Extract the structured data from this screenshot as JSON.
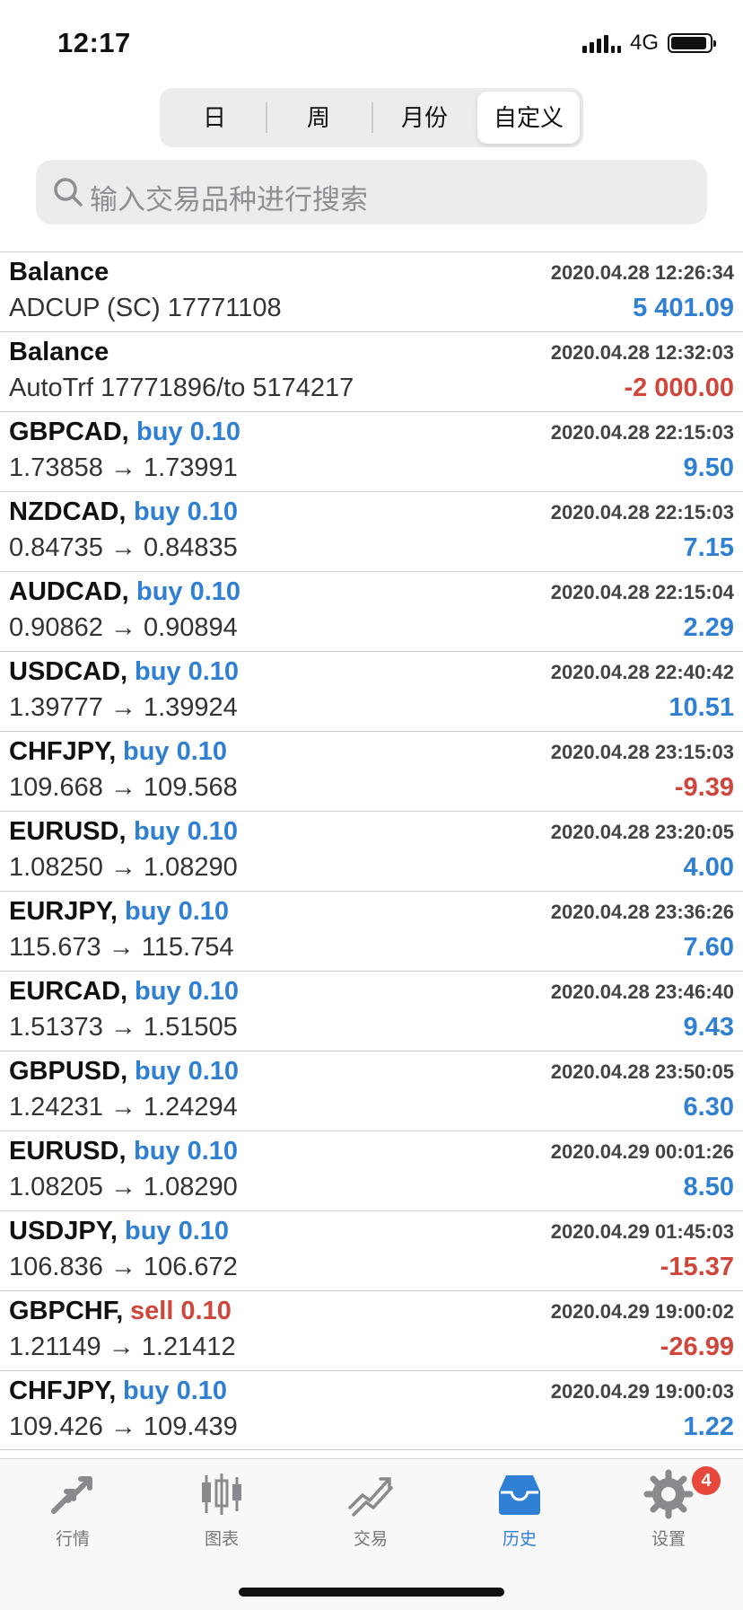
{
  "status_bar": {
    "time": "12:17",
    "network": "4G"
  },
  "segments": [
    {
      "label": "日"
    },
    {
      "label": "周"
    },
    {
      "label": "月份"
    },
    {
      "label": "自定义"
    }
  ],
  "active_segment": "自定义",
  "search": {
    "placeholder": "输入交易品种进行搜索"
  },
  "colors": {
    "buy": "#2f80d4",
    "sell": "#d0463a",
    "profit_positive": "#2f80d4",
    "profit_negative": "#d0463a"
  },
  "rows": [
    {
      "symbol": "Balance",
      "side": "",
      "detail": "ADCUP (SC) 17771108",
      "datetime": "2020.04.28 12:26:34",
      "profit": "5 401.09",
      "sign": "pos"
    },
    {
      "symbol": "Balance",
      "side": "",
      "detail": "AutoTrf 17771896/to 5174217",
      "datetime": "2020.04.28 12:32:03",
      "profit": "-2 000.00",
      "sign": "neg"
    },
    {
      "symbol": "GBPCAD,",
      "side": "buy 0.10",
      "detail": "1.73858 → 1.73991",
      "datetime": "2020.04.28 22:15:03",
      "profit": "9.50",
      "sign": "pos"
    },
    {
      "symbol": "NZDCAD,",
      "side": "buy 0.10",
      "detail": "0.84735 → 0.84835",
      "datetime": "2020.04.28 22:15:03",
      "profit": "7.15",
      "sign": "pos"
    },
    {
      "symbol": "AUDCAD,",
      "side": "buy 0.10",
      "detail": "0.90862 → 0.90894",
      "datetime": "2020.04.28 22:15:04",
      "profit": "2.29",
      "sign": "pos"
    },
    {
      "symbol": "USDCAD,",
      "side": "buy 0.10",
      "detail": "1.39777 → 1.39924",
      "datetime": "2020.04.28 22:40:42",
      "profit": "10.51",
      "sign": "pos"
    },
    {
      "symbol": "CHFJPY,",
      "side": "buy 0.10",
      "detail": "109.668 → 109.568",
      "datetime": "2020.04.28 23:15:03",
      "profit": "-9.39",
      "sign": "neg"
    },
    {
      "symbol": "EURUSD,",
      "side": "buy 0.10",
      "detail": "1.08250 → 1.08290",
      "datetime": "2020.04.28 23:20:05",
      "profit": "4.00",
      "sign": "pos"
    },
    {
      "symbol": "EURJPY,",
      "side": "buy 0.10",
      "detail": "115.673 → 115.754",
      "datetime": "2020.04.28 23:36:26",
      "profit": "7.60",
      "sign": "pos"
    },
    {
      "symbol": "EURCAD,",
      "side": "buy 0.10",
      "detail": "1.51373 → 1.51505",
      "datetime": "2020.04.28 23:46:40",
      "profit": "9.43",
      "sign": "pos"
    },
    {
      "symbol": "GBPUSD,",
      "side": "buy 0.10",
      "detail": "1.24231 → 1.24294",
      "datetime": "2020.04.28 23:50:05",
      "profit": "6.30",
      "sign": "pos"
    },
    {
      "symbol": "EURUSD,",
      "side": "buy 0.10",
      "detail": "1.08205 → 1.08290",
      "datetime": "2020.04.29 00:01:26",
      "profit": "8.50",
      "sign": "pos"
    },
    {
      "symbol": "USDJPY,",
      "side": "buy 0.10",
      "detail": "106.836 → 106.672",
      "datetime": "2020.04.29 01:45:03",
      "profit": "-15.37",
      "sign": "neg"
    },
    {
      "symbol": "GBPCHF,",
      "side": "sell 0.10",
      "detail": "1.21149 → 1.21412",
      "datetime": "2020.04.29 19:00:02",
      "profit": "-26.99",
      "sign": "neg"
    },
    {
      "symbol": "CHFJPY,",
      "side": "buy 0.10",
      "detail": "109.426 → 109.439",
      "datetime": "2020.04.29 19:00:03",
      "profit": "1.22",
      "sign": "pos"
    }
  ],
  "tabbar": {
    "items": [
      {
        "label": "行情",
        "icon": "quotes-icon"
      },
      {
        "label": "图表",
        "icon": "chart-icon"
      },
      {
        "label": "交易",
        "icon": "trade-icon"
      },
      {
        "label": "历史",
        "icon": "history-icon"
      },
      {
        "label": "设置",
        "icon": "settings-icon"
      }
    ],
    "active": "历史",
    "settings_badge": "4"
  }
}
